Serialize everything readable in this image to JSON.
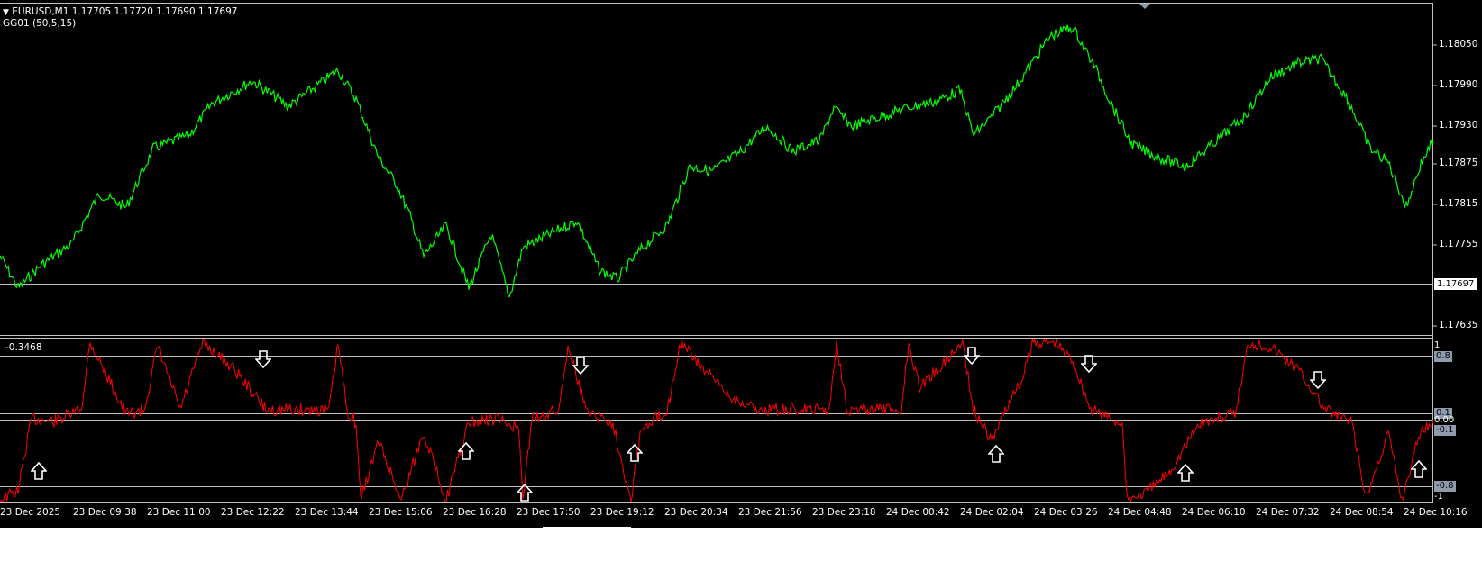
{
  "symbol_line": {
    "toggle": "▼",
    "text": "EURUSD,M1  1.17705 1.17720 1.17690 1.17697"
  },
  "indicator_name": "GG01 (50,5,15)",
  "indicator_value": "-0.3468",
  "current_price": "1.17697",
  "price_axis": [
    "1.18050",
    "1.17990",
    "1.17930",
    "1.17875",
    "1.17815",
    "1.17755",
    "1.17635"
  ],
  "indicator_axis": {
    "top": "1",
    "upper": "0.8",
    "p01": "0.1",
    "zero": "0.00",
    "m01": "-0.1",
    "lower": "-0.8",
    "bottom": "-1"
  },
  "time_axis": [
    "23 Dec 2025",
    "23 Dec 09:38",
    "23 Dec 11:00",
    "23 Dec 12:22",
    "23 Dec 13:44",
    "23 Dec 15:06",
    "23 Dec 16:28",
    "23 Dec 17:50",
    "23 Dec 19:12",
    "23 Dec 20:34",
    "23 Dec 21:56",
    "23 Dec 23:18",
    "24 Dec 00:42",
    "24 Dec 02:04",
    "24 Dec 03:26",
    "24 Dec 04:48",
    "24 Dec 06:10",
    "24 Dec 07:32",
    "24 Dec 08:54",
    "24 Dec 10:16"
  ],
  "colors": {
    "background": "#000000",
    "price_line": "#00ff00",
    "indicator_line": "#ff0000",
    "level_line": "#c0c0c0",
    "axis_box": "#8d9bac"
  },
  "signals": {
    "up_arrow_icon": "up-arrow-icon",
    "down_arrow_icon": "down-arrow-icon"
  }
}
